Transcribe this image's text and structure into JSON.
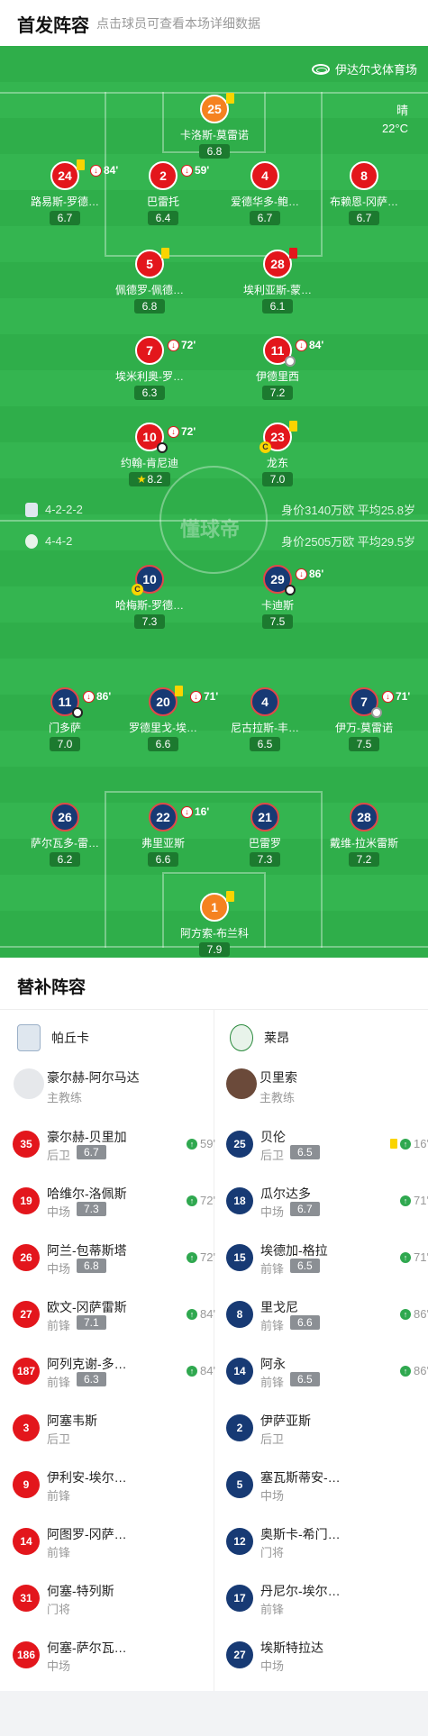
{
  "header": {
    "title": "首发阵容",
    "subtitle": "点击球员可查看本场详细数据"
  },
  "pitch": {
    "venue": "伊达尔戈体育场",
    "weather": {
      "condition": "晴",
      "temperature": "22°C"
    },
    "watermark": "懂球帝"
  },
  "home_team": {
    "formation": "4-2-2-2",
    "value_info": "身价3140万欧  平均25.8岁",
    "colors": {
      "circle": "#e3161c"
    },
    "players": [
      {
        "number": "25",
        "name": "卡洛斯-莫雷诺",
        "rating": "6.8"
      },
      {
        "number": "24",
        "name": "路易斯-罗德…",
        "rating": "6.7",
        "sub_out": "84'"
      },
      {
        "number": "2",
        "name": "巴雷托",
        "rating": "6.4",
        "sub_out": "59'"
      },
      {
        "number": "4",
        "name": "爱德华多-鲍…",
        "rating": "6.7"
      },
      {
        "number": "8",
        "name": "布赖恩-冈萨…",
        "rating": "6.7"
      },
      {
        "number": "5",
        "name": "佩德罗-佩德…",
        "rating": "6.8"
      },
      {
        "number": "28",
        "name": "埃利亚斯-蒙…",
        "rating": "6.1"
      },
      {
        "number": "7",
        "name": "埃米利奥-罗…",
        "rating": "6.3",
        "sub_out": "72'"
      },
      {
        "number": "11",
        "name": "伊德里西",
        "rating": "7.2",
        "sub_out": "84'"
      },
      {
        "number": "10",
        "name": "约翰-肯尼迪",
        "rating": "8.2",
        "sub_out": "72'"
      },
      {
        "number": "23",
        "name": "龙东",
        "rating": "7.0"
      }
    ]
  },
  "away_team": {
    "formation": "4-4-2",
    "value_info": "身价2505万欧  平均29.5岁",
    "colors": {
      "circle": "#173a74"
    },
    "players": [
      {
        "number": "10",
        "name": "哈梅斯-罗德…",
        "rating": "7.3"
      },
      {
        "number": "29",
        "name": "卡迪斯",
        "rating": "7.5",
        "sub_out": "86'"
      },
      {
        "number": "11",
        "name": "门多萨",
        "rating": "7.0",
        "sub_out": "86'"
      },
      {
        "number": "20",
        "name": "罗德里戈-埃…",
        "rating": "6.6",
        "sub_out": "71'"
      },
      {
        "number": "4",
        "name": "尼古拉斯-丰…",
        "rating": "6.5"
      },
      {
        "number": "7",
        "name": "伊万-莫雷诺",
        "rating": "7.5",
        "sub_out": "71'"
      },
      {
        "number": "26",
        "name": "萨尔瓦多-雷…",
        "rating": "6.2"
      },
      {
        "number": "22",
        "name": "弗里亚斯",
        "rating": "6.6",
        "sub_out": "16'"
      },
      {
        "number": "21",
        "name": "巴雷罗",
        "rating": "7.3"
      },
      {
        "number": "28",
        "name": "戴维-拉米雷斯",
        "rating": "7.2"
      },
      {
        "number": "1",
        "name": "阿方索-布兰科",
        "rating": "7.9"
      }
    ]
  },
  "subs": {
    "title": "替补阵容",
    "home": {
      "team_name": "帕丘卡",
      "coach": {
        "name": "豪尔赫-阿尔马达",
        "role": "主教练"
      },
      "players": [
        {
          "number": "35",
          "name": "豪尔赫-贝里加",
          "position": "后卫",
          "rating": "6.7",
          "time": "59'"
        },
        {
          "number": "19",
          "name": "哈维尔-洛佩斯",
          "position": "中场",
          "rating": "7.3",
          "time": "72'"
        },
        {
          "number": "26",
          "name": "阿兰-包蒂斯塔",
          "position": "中场",
          "rating": "6.8",
          "time": "72'"
        },
        {
          "number": "27",
          "name": "欧文-冈萨雷斯",
          "position": "前锋",
          "rating": "7.1",
          "time": "84'"
        },
        {
          "number": "187",
          "name": "阿列克谢-多…",
          "position": "前锋",
          "rating": "6.3",
          "time": "84'"
        },
        {
          "number": "3",
          "name": "阿塞韦斯",
          "position": "后卫"
        },
        {
          "number": "9",
          "name": "伊利安-埃尔…",
          "position": "前锋"
        },
        {
          "number": "14",
          "name": "阿图罗-冈萨…",
          "position": "前锋"
        },
        {
          "number": "31",
          "name": "何塞-特列斯",
          "position": "门将"
        },
        {
          "number": "186",
          "name": "何塞-萨尔瓦…",
          "position": "中场"
        }
      ]
    },
    "away": {
      "team_name": "莱昂",
      "coach": {
        "name": "贝里索",
        "role": "主教练"
      },
      "players": [
        {
          "number": "25",
          "name": "贝伦",
          "position": "后卫",
          "rating": "6.5",
          "time": "16'",
          "yellow": true
        },
        {
          "number": "18",
          "name": "瓜尔达多",
          "position": "中场",
          "rating": "6.7",
          "time": "71'"
        },
        {
          "number": "15",
          "name": "埃德加-格拉",
          "position": "前锋",
          "rating": "6.5",
          "time": "71'"
        },
        {
          "number": "8",
          "name": "里戈尼",
          "position": "前锋",
          "rating": "6.6",
          "time": "86'"
        },
        {
          "number": "14",
          "name": "阿永",
          "position": "前锋",
          "rating": "6.5",
          "time": "86'"
        },
        {
          "number": "2",
          "name": "伊萨亚斯",
          "position": "后卫"
        },
        {
          "number": "5",
          "name": "塞瓦斯蒂安-…",
          "position": "中场"
        },
        {
          "number": "12",
          "name": "奥斯卡-希门…",
          "position": "门将"
        },
        {
          "number": "17",
          "name": "丹尼尔-埃尔…",
          "position": "前锋"
        },
        {
          "number": "27",
          "name": "埃斯特拉达",
          "position": "中场"
        }
      ]
    }
  }
}
